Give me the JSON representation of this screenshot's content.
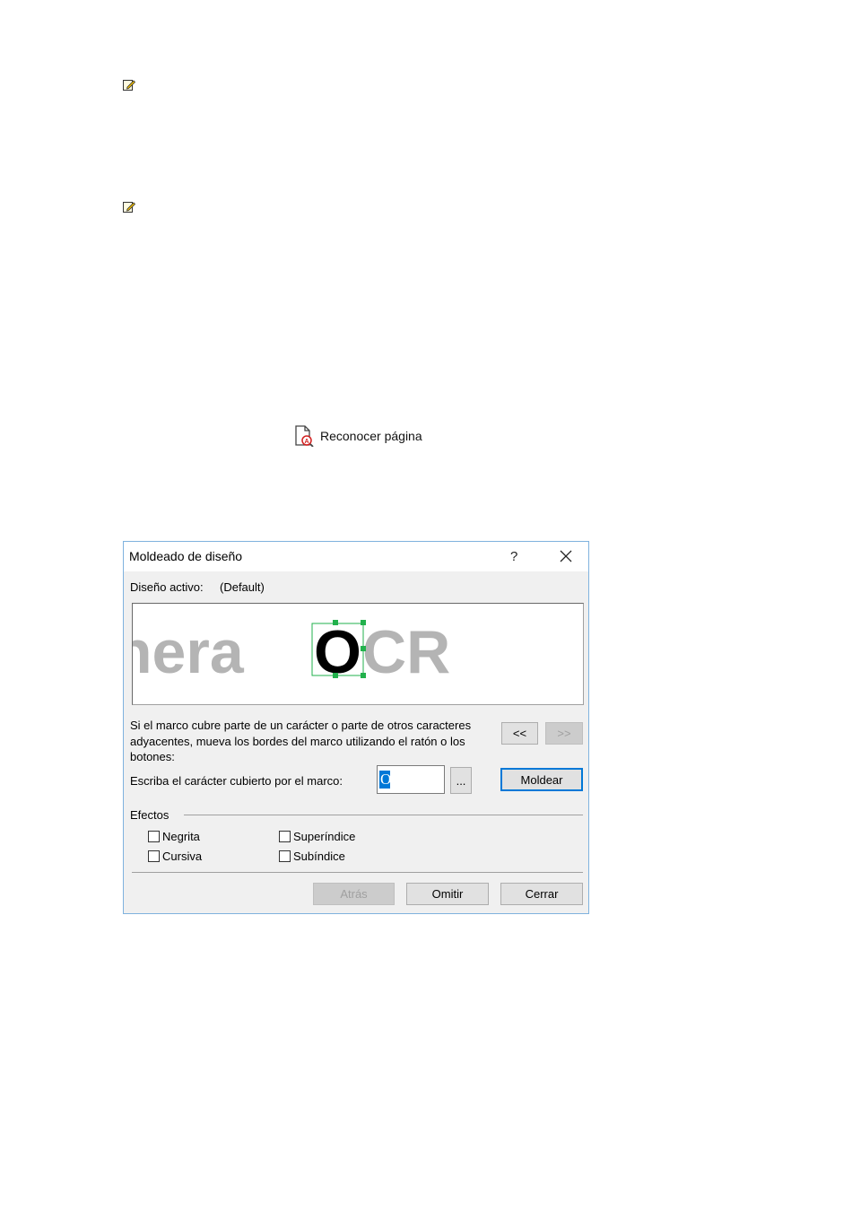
{
  "page": {
    "recognize_page_label": "Reconocer página"
  },
  "dialog": {
    "title": "Moldeado de diseño",
    "help_label": "?",
    "active_layout_label": "Diseño activo:",
    "active_layout_value": "(Default)",
    "preview_text_left": "nera",
    "preview_char": "O",
    "preview_text_right": "CR",
    "instructions": "Si el marco cubre parte de un carácter o parte de otros caracteres adyacentes, mueva los bordes del marco utilizando el ratón o los botones:",
    "prev_button": "<<",
    "next_button": ">>",
    "char_label": "Escriba el carácter cubierto por el marco:",
    "char_value": "O",
    "browse_button": "...",
    "train_button": "Moldear",
    "effects_label": "Efectos",
    "effects": {
      "bold": "Negrita",
      "italic": "Cursiva",
      "superscript": "Superíndice",
      "subscript": "Subíndice"
    },
    "back_button": "Atrás",
    "skip_button": "Omitir",
    "close_button": "Cerrar"
  },
  "colors": {
    "frame_green": "#22b14c",
    "preview_gray": "#b4b4b4",
    "accent": "#0078d7"
  }
}
